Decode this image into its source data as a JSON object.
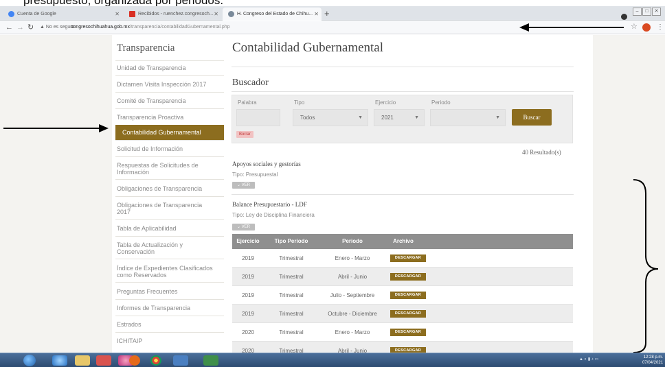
{
  "caption": {
    "text": "presupuesto, organizada por periodos."
  },
  "browser": {
    "tabs": [
      {
        "label": "Cuenta de Google"
      },
      {
        "label": "Recibidos - ruenchez.congresoch..."
      },
      {
        "label": "H. Congreso del Estado de Chihu..."
      }
    ],
    "new_tab": "+",
    "security_label": "No es seguro",
    "url_host": "congresochihuahua.gob.mx",
    "url_path": "/transparencia/contabilidadGubernamental.php",
    "profile_initial": "C"
  },
  "sidebar": {
    "title": "Transparencia",
    "items": [
      {
        "label": "Unidad de Transparencia"
      },
      {
        "label": "Dictamen Visita Inspección 2017"
      },
      {
        "label": "Comité de Transparencia"
      },
      {
        "label": "Transparencia Proactiva"
      },
      {
        "label": "Contabilidad Gubernamental"
      },
      {
        "label": "Solicitud de Información"
      },
      {
        "label": "Respuestas de Solicitudes de Información"
      },
      {
        "label": "Obligaciones de Transparencia"
      },
      {
        "label": "Obligaciones de Transparencia 2017"
      },
      {
        "label": "Tabla de Aplicabilidad"
      },
      {
        "label": "Tabla de Actualización y Conservación"
      },
      {
        "label": "Índice de Expedientes Clasificados como Reservados"
      },
      {
        "label": "Preguntas Frecuentes"
      },
      {
        "label": "Informes de Transparencia"
      },
      {
        "label": "Estrados"
      },
      {
        "label": "ICHITAIP"
      }
    ]
  },
  "main": {
    "title": "Contabilidad Gubernamental",
    "buscador_title": "Buscador",
    "search": {
      "palabra_label": "Palabra",
      "palabra_value": "",
      "tipo_label": "Tipo",
      "tipo_value": "Todos",
      "ejercicio_label": "Ejercicio",
      "ejercicio_value": "2021",
      "periodo_label": "Periodo",
      "periodo_value": "",
      "buscar_label": "Buscar",
      "borrar_label": "Borrar"
    },
    "results_count": "40 Resultado(s)",
    "entries": [
      {
        "title": "Apoyos sociales y gestorías",
        "type": "Tipo: Presupuestal",
        "ver_label": "VER"
      },
      {
        "title": "Balance Presupuestario - LDF",
        "type": "Tipo: Ley de Disciplina Financiera",
        "ver_label": "VER"
      }
    ],
    "table": {
      "headers": [
        "Ejercicio",
        "Tipo Periodo",
        "Periodo",
        "Archivo"
      ],
      "rows": [
        {
          "ejercicio": "2019",
          "tipo": "Trimestral",
          "periodo": "Enero - Marzo",
          "archivo": "DESCARGAR"
        },
        {
          "ejercicio": "2019",
          "tipo": "Trimestral",
          "periodo": "Abril - Junio",
          "archivo": "DESCARGAR"
        },
        {
          "ejercicio": "2019",
          "tipo": "Trimestral",
          "periodo": "Julio - Septiembre",
          "archivo": "DESCARGAR"
        },
        {
          "ejercicio": "2019",
          "tipo": "Trimestral",
          "periodo": "Octubre - Diciembre",
          "archivo": "DESCARGAR"
        },
        {
          "ejercicio": "2020",
          "tipo": "Trimestral",
          "periodo": "Enero - Marzo",
          "archivo": "DESCARGAR"
        },
        {
          "ejercicio": "2020",
          "tipo": "Trimestral",
          "periodo": "Abril - Junio",
          "archivo": "DESCARGAR"
        }
      ]
    }
  },
  "taskbar": {
    "clock_time": "12:28 p.m.",
    "clock_date": "07/04/2021"
  },
  "colors": {
    "accent": "#8c6d1f",
    "table_header": "#8f8f8f"
  }
}
